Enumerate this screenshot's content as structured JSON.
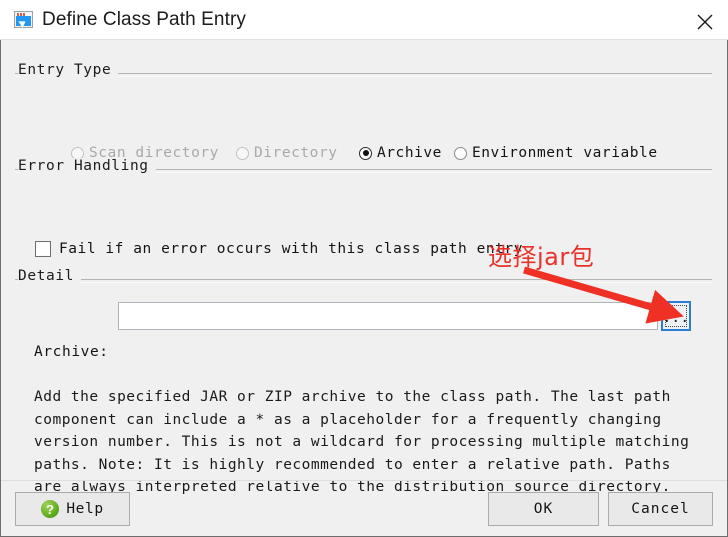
{
  "window": {
    "title": "Define Class Path Entry",
    "icon": "app-window-icon",
    "close_icon": "close-icon"
  },
  "groups": {
    "entry_type": {
      "label": "Entry Type",
      "options": [
        {
          "label": "Scan directory",
          "checked": false,
          "disabled": true
        },
        {
          "label": "Directory",
          "checked": false,
          "disabled": true
        },
        {
          "label": "Archive",
          "checked": true,
          "disabled": false
        },
        {
          "label": "Environment variable",
          "checked": false,
          "disabled": false
        }
      ]
    },
    "error_handling": {
      "label": "Error Handling",
      "checkbox": {
        "label": "Fail if an error occurs with this class path entry",
        "checked": false
      }
    },
    "detail": {
      "label": "Detail",
      "field_label": "Archive:",
      "field_value": "",
      "field_placeholder": "",
      "browse_label": "...",
      "description": "Add the specified JAR or ZIP archive to the class path. The last path component can include a * as a placeholder for a frequently changing version number. This is not a wildcard for processing multiple matching paths. Note: It is highly recommended to enter a relative path. Paths are always interpreted relative to the distribution source directory."
    }
  },
  "footer": {
    "help_label": "Help",
    "help_icon": "question-mark-icon",
    "ok_label": "OK",
    "cancel_label": "Cancel"
  },
  "annotation": {
    "text": "选择jar包",
    "color": "#e8332a"
  }
}
